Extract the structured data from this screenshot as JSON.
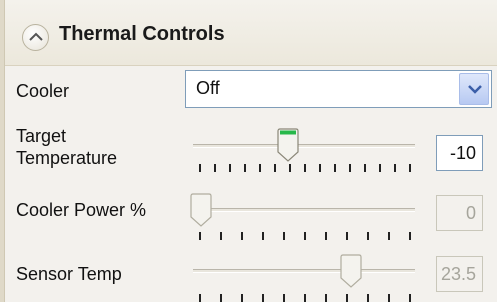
{
  "section": {
    "title": "Thermal Controls",
    "collapse_icon": "chevron-up-icon"
  },
  "cooler": {
    "label": "Cooler",
    "value": "Off",
    "dropdown_icon": "chevron-down-icon"
  },
  "target_temperature": {
    "label_line1": "Target",
    "label_line2": "Temperature",
    "value": "-10",
    "slider_fraction": 0.42,
    "enabled": true
  },
  "cooler_power": {
    "label": "Cooler Power %",
    "value": "0",
    "slider_fraction": 0.0,
    "enabled": false
  },
  "sensor_temp": {
    "label": "Sensor Temp",
    "value": "23.5",
    "slider_fraction": 0.73,
    "enabled": false
  },
  "colors": {
    "accent_green": "#27b84a",
    "border_blue": "#7f9db9",
    "disabled_text": "#a6a59c"
  }
}
